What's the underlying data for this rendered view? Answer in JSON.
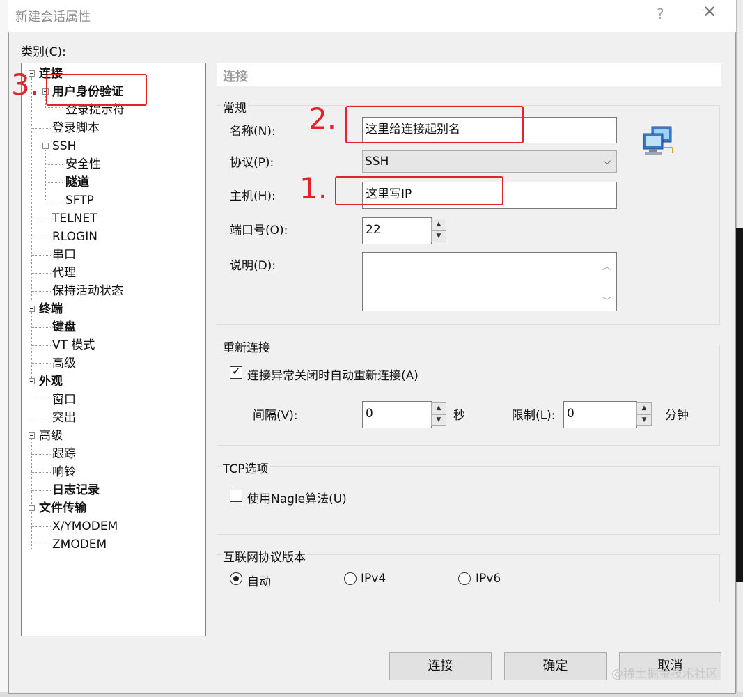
{
  "window": {
    "title": "新建会话属性",
    "help_glyph": "?",
    "close_glyph": "✕"
  },
  "category_label": "类别(C):",
  "tree": [
    {
      "label": "连接",
      "bold": true
    },
    {
      "label": "用户身份验证",
      "bold": true
    },
    {
      "label": "登录提示符",
      "bold": false
    },
    {
      "label": "登录脚本",
      "bold": false
    },
    {
      "label": "SSH",
      "bold": false
    },
    {
      "label": "安全性",
      "bold": false
    },
    {
      "label": "隧道",
      "bold": true
    },
    {
      "label": "SFTP",
      "bold": false
    },
    {
      "label": "TELNET",
      "bold": false
    },
    {
      "label": "RLOGIN",
      "bold": false
    },
    {
      "label": "串口",
      "bold": false
    },
    {
      "label": "代理",
      "bold": false
    },
    {
      "label": "保持活动状态",
      "bold": false
    },
    {
      "label": "终端",
      "bold": true
    },
    {
      "label": "键盘",
      "bold": true
    },
    {
      "label": "VT 模式",
      "bold": false
    },
    {
      "label": "高级",
      "bold": false
    },
    {
      "label": "外观",
      "bold": true
    },
    {
      "label": "窗口",
      "bold": false
    },
    {
      "label": "突出",
      "bold": false
    },
    {
      "label": "高级",
      "bold": false
    },
    {
      "label": "跟踪",
      "bold": false
    },
    {
      "label": "响铃",
      "bold": false
    },
    {
      "label": "日志记录",
      "bold": true
    },
    {
      "label": "文件传输",
      "bold": true
    },
    {
      "label": "X/YMODEM",
      "bold": false
    },
    {
      "label": "ZMODEM",
      "bold": false
    }
  ],
  "panel_header": "连接",
  "general": {
    "title": "常规",
    "name_label": "名称(N):",
    "name_value": "这里给连接起别名",
    "protocol_label": "协议(P):",
    "protocol_value": "SSH",
    "host_label": "主机(H):",
    "host_value": "这里写IP",
    "port_label": "端口号(O):",
    "port_value": "22",
    "desc_label": "说明(D):",
    "desc_value": ""
  },
  "reconnect": {
    "title": "重新连接",
    "checkbox_label": "连接异常关闭时自动重新连接(A)",
    "checked": true,
    "interval_label": "间隔(V):",
    "interval_value": "0",
    "interval_unit": "秒",
    "limit_label": "限制(L):",
    "limit_value": "0",
    "limit_unit": "分钟"
  },
  "tcp": {
    "title": "TCP选项",
    "nagle_label": "使用Nagle算法(U)",
    "checked": false
  },
  "ip_version": {
    "title": "互联网协议版本",
    "options": [
      "自动",
      "IPv4",
      "IPv6"
    ],
    "selected": "自动"
  },
  "buttons": {
    "connect": "连接",
    "ok": "确定",
    "cancel": "取消"
  },
  "annotations": {
    "n1": "1.",
    "n2": "2.",
    "n3": "3.",
    "color": "#e0242a"
  },
  "watermark": "@稀土掘金技术社区"
}
